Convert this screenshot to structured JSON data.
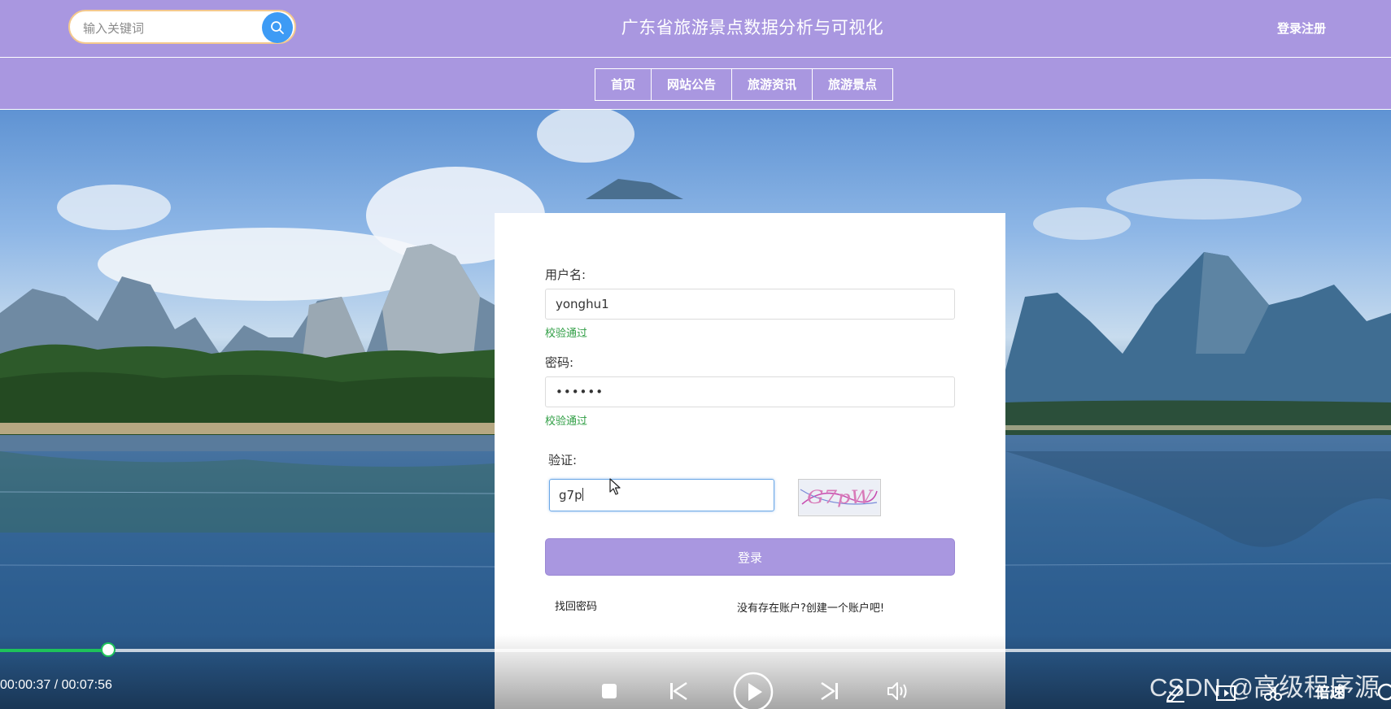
{
  "header": {
    "search_placeholder": "输入关键词",
    "site_title": "广东省旅游景点数据分析与可视化",
    "login_link": "登录注册"
  },
  "nav": {
    "items": [
      {
        "label": "首页"
      },
      {
        "label": "网站公告"
      },
      {
        "label": "旅游资讯"
      },
      {
        "label": "旅游景点"
      }
    ]
  },
  "login_form": {
    "username_label": "用户名:",
    "username_value": "yonghu1",
    "username_valid": "校验通过",
    "password_label": "密码:",
    "password_value": "••••••",
    "password_valid": "校验通过",
    "captcha_label": "验证:",
    "captcha_value": "g7p",
    "captcha_image_text": "G7pW",
    "submit_label": "登录",
    "forgot_link": "找回密码",
    "register_link": "没有存在账户?创建一个账户吧!"
  },
  "player": {
    "time": "00:00:37 / 00:07:56",
    "progress_fraction": 0.0777,
    "speed_label": "倍速",
    "watermark": "CSDN @高级程序源"
  },
  "colors": {
    "theme": "#a997e0",
    "search_button": "#3d9bf5",
    "valid_text": "#2f9e44",
    "progress": "#1ec35a"
  }
}
